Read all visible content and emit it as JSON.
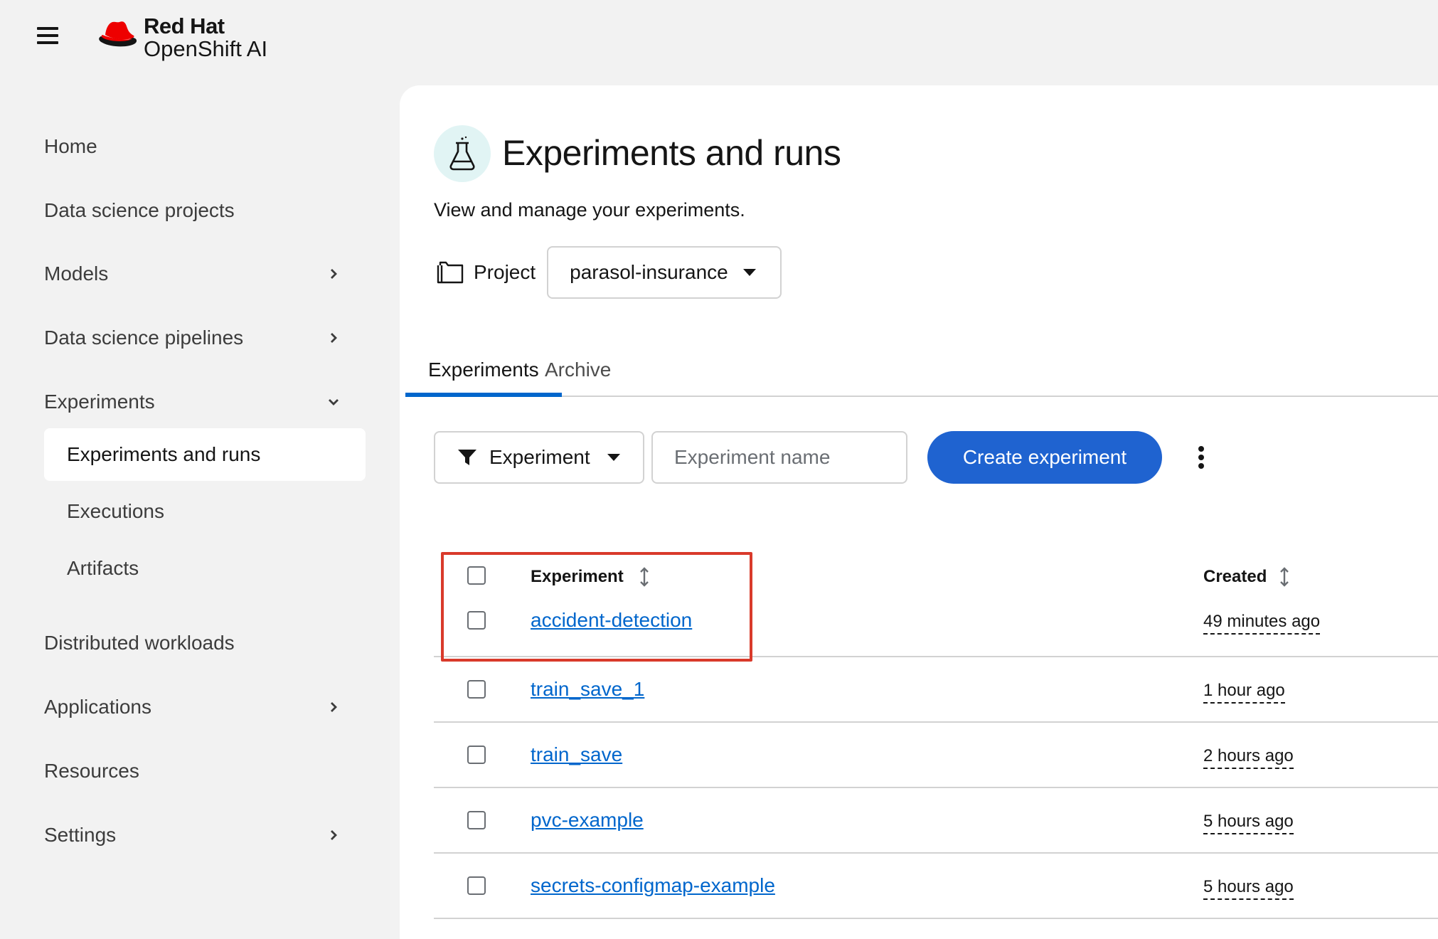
{
  "masthead": {
    "brand": "Red Hat",
    "product": "OpenShift AI"
  },
  "sidebar": {
    "items": [
      {
        "label": "Home"
      },
      {
        "label": "Data science projects"
      },
      {
        "label": "Models",
        "expandable": true
      },
      {
        "label": "Data science pipelines",
        "expandable": true
      },
      {
        "label": "Experiments",
        "expanded": true
      },
      {
        "label": "Distributed workloads"
      },
      {
        "label": "Applications",
        "expandable": true
      },
      {
        "label": "Resources"
      },
      {
        "label": "Settings",
        "expandable": true
      }
    ],
    "sub_items": [
      {
        "label": "Experiments and runs",
        "active": true
      },
      {
        "label": "Executions"
      },
      {
        "label": "Artifacts"
      }
    ]
  },
  "page": {
    "title": "Experiments and runs",
    "description": "View and manage your experiments.",
    "project_label": "Project",
    "project_value": "parasol-insurance"
  },
  "tabs": [
    {
      "label": "Experiments",
      "active": true
    },
    {
      "label": "Archive"
    }
  ],
  "toolbar": {
    "filter_label": "Experiment",
    "search_placeholder": "Experiment name",
    "create_label": "Create experiment"
  },
  "table": {
    "columns": [
      "Experiment",
      "Created"
    ],
    "rows": [
      {
        "name": "accident-detection",
        "created": "49 minutes ago"
      },
      {
        "name": "train_save_1",
        "created": "1 hour ago"
      },
      {
        "name": "train_save",
        "created": "2 hours ago"
      },
      {
        "name": "pvc-example",
        "created": "5 hours ago"
      },
      {
        "name": "secrets-configmap-example",
        "created": "5 hours ago"
      }
    ]
  },
  "colors": {
    "accent": "#0066cc",
    "primary_button": "#1f63d0",
    "highlight": "#d93a2b",
    "icon_bg": "#e1f4f4",
    "brand_red": "#ee0000"
  }
}
